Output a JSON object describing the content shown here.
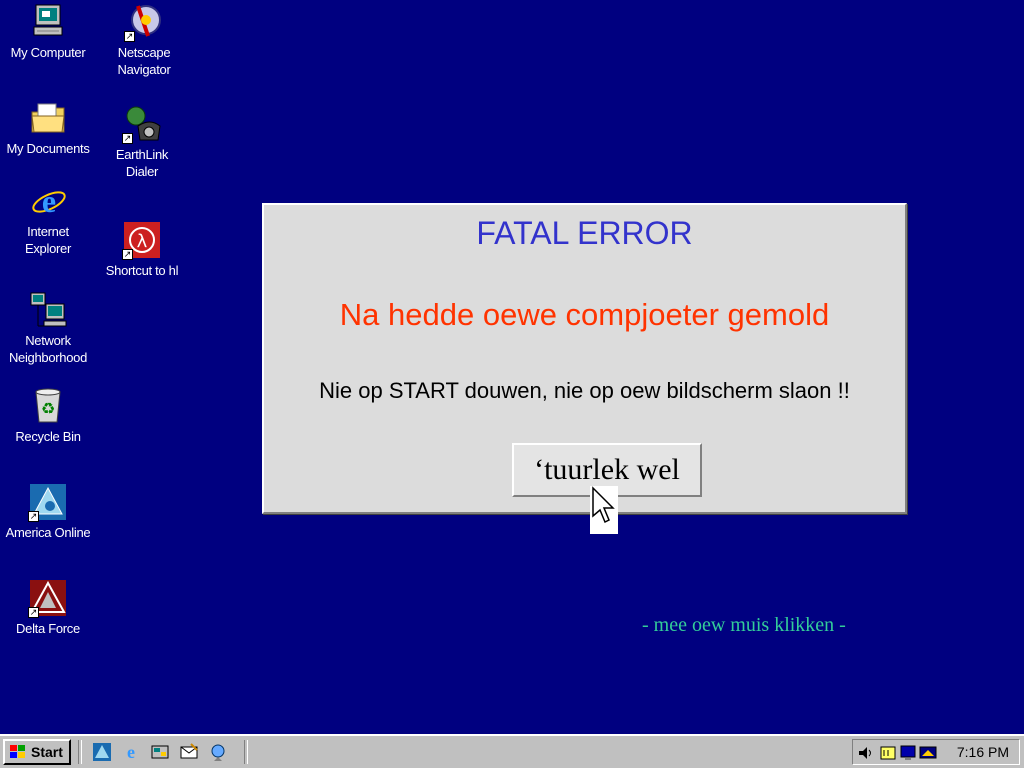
{
  "desktop": {
    "background_color": "#000080",
    "icons": [
      {
        "label_lines": [
          "My Computer"
        ],
        "icon": "my-computer-icon"
      },
      {
        "label_lines": [
          "Netscape",
          "Navigator"
        ],
        "icon": "netscape-navigator-icon",
        "shortcut": true
      },
      {
        "label_lines": [
          "My Documents"
        ],
        "icon": "my-documents-icon"
      },
      {
        "label_lines": [
          "EarthLink",
          "Dialer"
        ],
        "icon": "earthlink-dialer-icon",
        "shortcut": true
      },
      {
        "label_lines": [
          "Internet",
          "Explorer"
        ],
        "icon": "internet-explorer-icon"
      },
      {
        "label_lines": [
          "Shortcut to hl"
        ],
        "icon": "half-life-icon",
        "shortcut": true
      },
      {
        "label_lines": [
          "Network",
          "Neighborhood"
        ],
        "icon": "network-neighborhood-icon"
      },
      {
        "label_lines": [
          "Recycle Bin"
        ],
        "icon": "recycle-bin-icon"
      },
      {
        "label_lines": [
          "America Online"
        ],
        "icon": "america-online-icon",
        "shortcut": true
      },
      {
        "label_lines": [
          "Delta Force"
        ],
        "icon": "delta-force-icon",
        "shortcut": true
      }
    ]
  },
  "dialog": {
    "title": "FATAL ERROR",
    "subtitle": "Na hedde oewe compjoeter gemold",
    "message": "Nie op START douwen, nie op oew bildscherm slaon !!",
    "button_label": "‘tuurlek wel",
    "title_color": "#3333cc",
    "subtitle_color": "#ff3300"
  },
  "hint": "- mee oew muis klikken -",
  "hint_color": "#33cc99",
  "taskbar": {
    "start_label": "Start",
    "quick_launch": [
      "aol-icon",
      "internet-explorer-icon",
      "show-desktop-icon",
      "outlook-express-icon",
      "channels-icon"
    ],
    "tray": [
      "volume-icon",
      "task-scheduler-icon",
      "display-icon",
      "monitor-icon"
    ],
    "clock": "7:16 PM"
  }
}
